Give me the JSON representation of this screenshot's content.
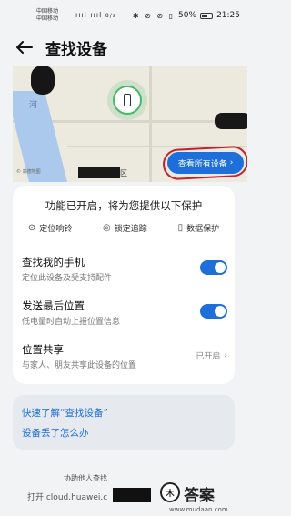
{
  "status_bar": {
    "carrier1": "中国移动",
    "carrier2": "中国移动",
    "signal": "ıııl ıııl",
    "net_speed": "8/s",
    "icons": "✱ ⊘ ⊘ ▯",
    "battery": "50%",
    "time": "21:25"
  },
  "header": {
    "title": "查找设备",
    "back_icon": "back-arrow-icon"
  },
  "map": {
    "river_label": "河",
    "place_label": "区",
    "view_all_label": "查看所有设备",
    "legal_text": "© 高德地图"
  },
  "features": {
    "title": "功能已开启，将为您提供以下保护",
    "items": [
      {
        "icon": "location-icon",
        "label": "定位响铃"
      },
      {
        "icon": "lock-icon",
        "label": "锁定追踪"
      },
      {
        "icon": "phone-icon",
        "label": "数据保护"
      }
    ]
  },
  "settings": {
    "find_phone": {
      "title": "查找我的手机",
      "subtitle": "定位此设备及受支持配件",
      "enabled": true
    },
    "last_location": {
      "title": "发送最后位置",
      "subtitle": "低电量时自动上报位置信息",
      "enabled": true
    },
    "share_location": {
      "title": "位置共享",
      "subtitle": "与家人、朋友共享此设备的位置",
      "value": "已开启"
    }
  },
  "links": {
    "learn": "快速了解“查找设备”",
    "lost": "设备丢了怎么办"
  },
  "help_text": "协助他人查找",
  "footer_text": "打开 cloud.huawei.c",
  "watermark": {
    "badge": "木",
    "text": "答案",
    "url": "www.mudaan.com"
  },
  "colors": {
    "accent": "#1e6fd9",
    "background": "#f1f3f5",
    "pin": "#49b86b",
    "highlight": "#c0232b"
  }
}
